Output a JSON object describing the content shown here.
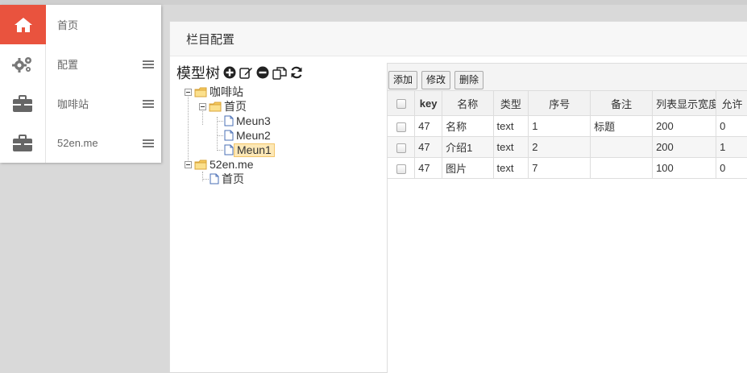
{
  "sidebar": {
    "items": [
      {
        "label": "首页",
        "icon": "home-icon"
      },
      {
        "label": "配置",
        "icon": "gears-icon"
      },
      {
        "label": "咖啡站",
        "icon": "briefcase-icon"
      },
      {
        "label": "52en.me",
        "icon": "briefcase-icon"
      }
    ]
  },
  "panel": {
    "title": "栏目配置"
  },
  "tree": {
    "title": "模型树",
    "nodes": {
      "site1": "咖啡站",
      "home1": "首页",
      "menu3": "Meun3",
      "menu2": "Meun2",
      "menu1": "Meun1",
      "site2": "52en.me",
      "home2": "首页"
    }
  },
  "toolbar": {
    "add": "添加",
    "edit": "修改",
    "delete": "删除"
  },
  "table": {
    "columns": [
      "key",
      "名称",
      "类型",
      "序号",
      "备注",
      "列表显示宽度",
      "允许"
    ],
    "rows": [
      [
        "47",
        "名称",
        "text",
        "1",
        "标题",
        "200",
        "0"
      ],
      [
        "47",
        "介绍1",
        "text",
        "2",
        "",
        "200",
        "1"
      ],
      [
        "47",
        "图片",
        "text",
        "7",
        "",
        "100",
        "0"
      ]
    ]
  },
  "colors": {
    "accent": "#e9533e",
    "folder": "#f5c95c"
  }
}
